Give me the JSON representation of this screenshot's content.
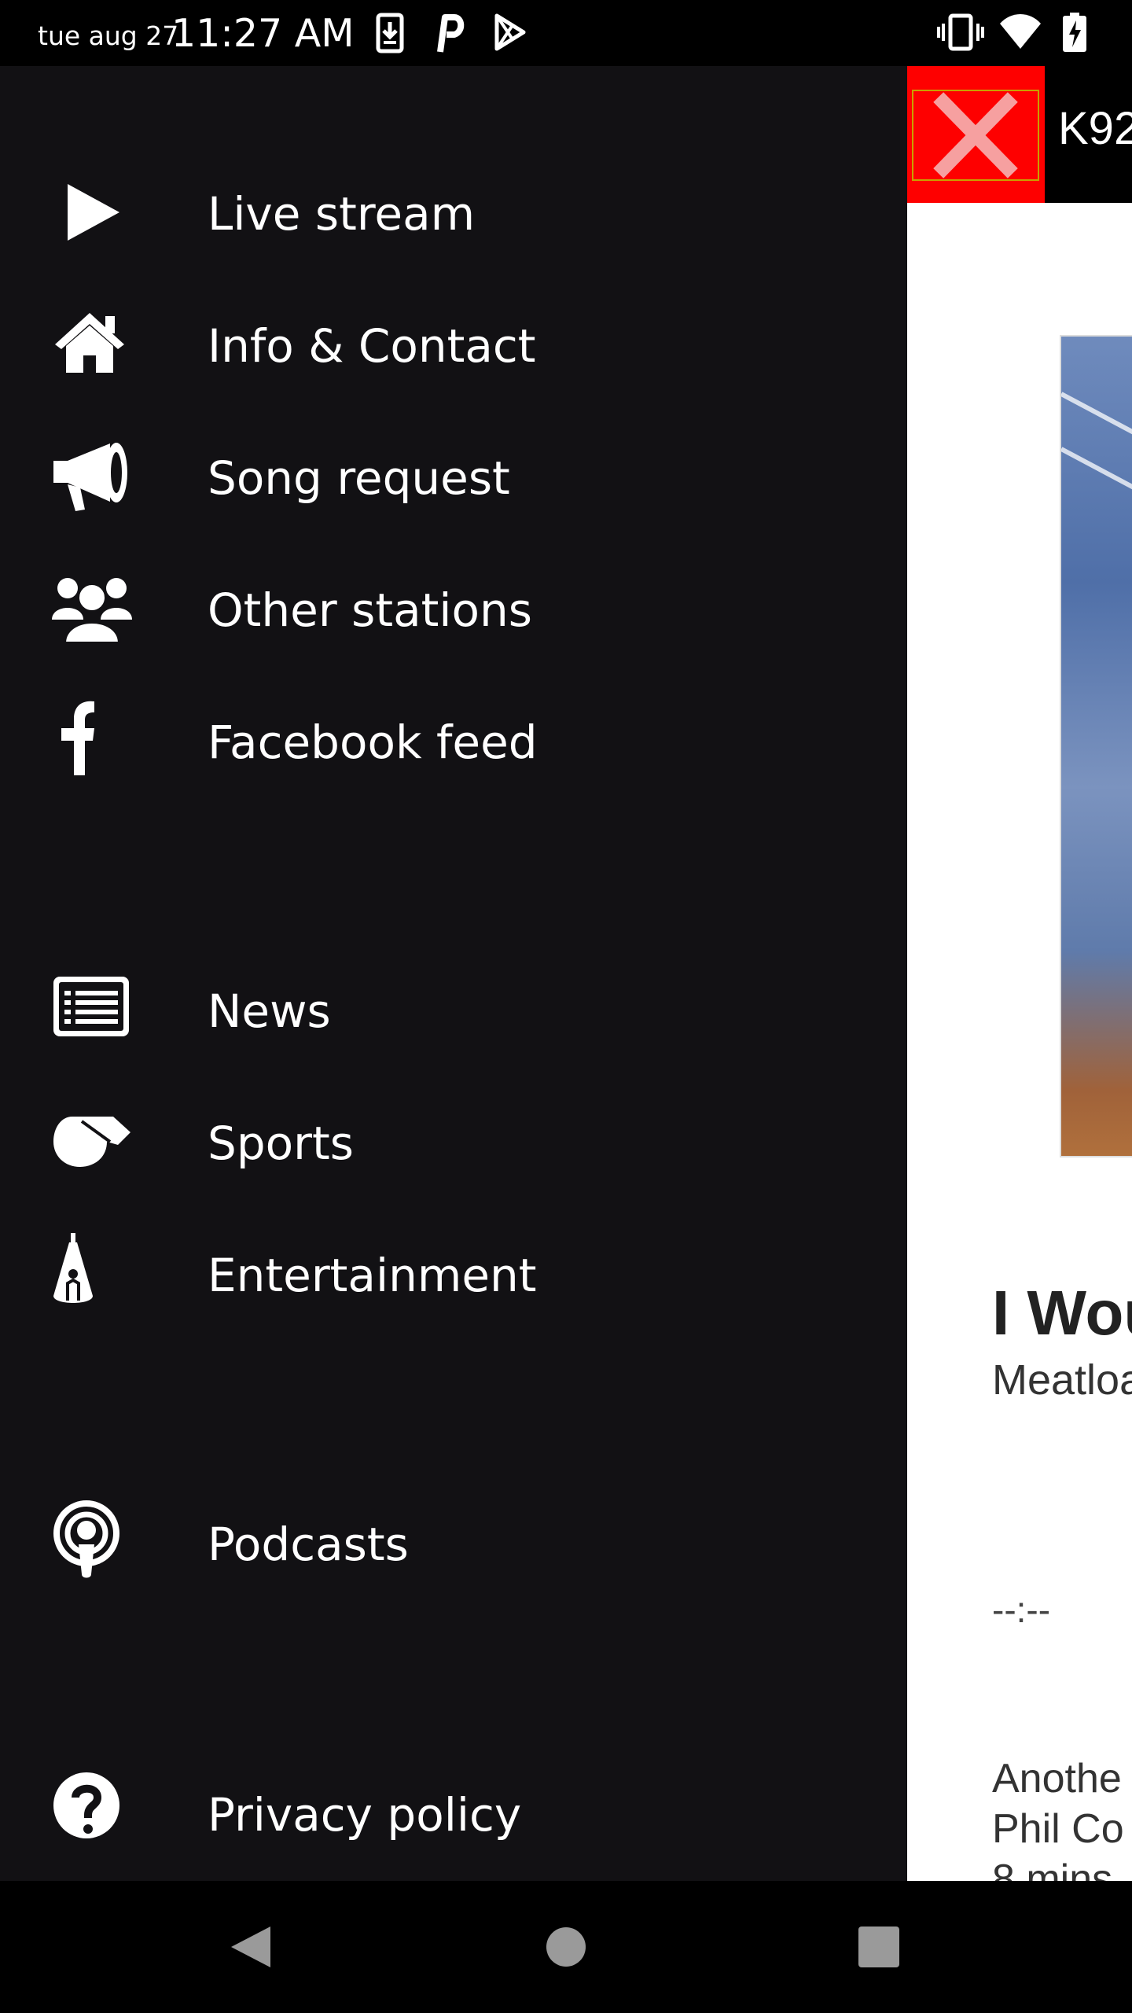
{
  "status_bar": {
    "date": "tue aug 27",
    "time": "11:27 AM",
    "left_icons": [
      "download-icon",
      "parking-p-icon",
      "play-store-icon"
    ],
    "right_icons": [
      "vibrate-icon",
      "wifi-icon",
      "battery-charging-icon"
    ]
  },
  "drawer": {
    "items": [
      {
        "label": "Live stream",
        "icon": "play-icon"
      },
      {
        "label": "Info & Contact",
        "icon": "home-icon"
      },
      {
        "label": "Song request",
        "icon": "megaphone-icon"
      },
      {
        "label": "Other stations",
        "icon": "group-icon"
      },
      {
        "label": "Facebook feed",
        "icon": "facebook-icon"
      },
      {
        "label": "News",
        "icon": "newspaper-icon"
      },
      {
        "label": "Sports",
        "icon": "whistle-icon"
      },
      {
        "label": "Entertainment",
        "icon": "spotlight-icon"
      },
      {
        "label": "Podcasts",
        "icon": "podcast-icon"
      },
      {
        "label": "Privacy policy",
        "icon": "question-icon"
      }
    ]
  },
  "player": {
    "station_title": "K92",
    "song_title": "I Wou",
    "song_artist": "Meatloa",
    "progress_time": "--:--",
    "previous_label": "Anothe",
    "previous_artist": "Phil Co",
    "previous_time": "8 mins"
  },
  "colors": {
    "drawer_bg": "#121114",
    "close_button": "#fe0000",
    "header_bg": "#000000"
  },
  "navbar": {
    "buttons": [
      "back-icon",
      "home-circle-icon",
      "recents-icon"
    ]
  }
}
